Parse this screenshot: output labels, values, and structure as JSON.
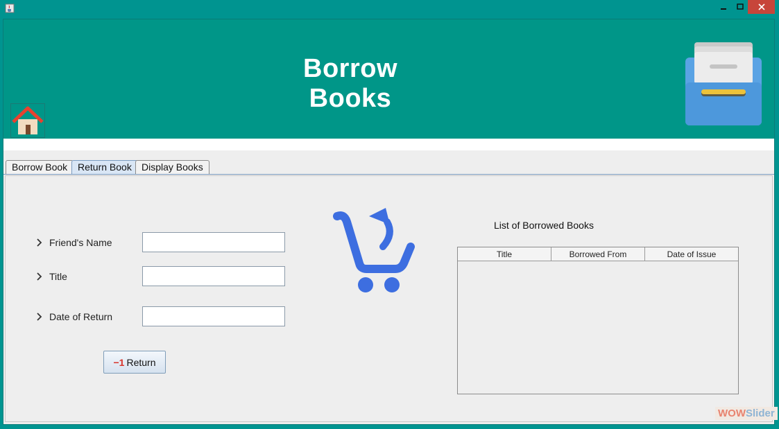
{
  "window": {
    "icon": "java-cup-icon"
  },
  "header": {
    "title": "Borrow Books",
    "home_icon": "home-icon",
    "drawer_icon": "file-drawer-icon"
  },
  "tabs": [
    {
      "label": "Borrow Book",
      "active": false
    },
    {
      "label": "Return Book",
      "active": true
    },
    {
      "label": "Display Books",
      "active": false
    }
  ],
  "form": {
    "fields": [
      {
        "label": "Friend's Name",
        "value": ""
      },
      {
        "label": "Title",
        "value": ""
      },
      {
        "label": "Date of Return",
        "value": ""
      }
    ],
    "return_label": "Return",
    "return_icon_text": "−1"
  },
  "center_icon": "cart-return-icon",
  "list": {
    "title": "List of Borrowed Books",
    "columns": [
      "Title",
      "Borrowed From",
      "Date of Issue"
    ],
    "rows": []
  },
  "watermark": {
    "part1": "WOW",
    "part2": "Slider"
  },
  "colors": {
    "teal": "#009688",
    "tab_active": "#d9e6f5",
    "close": "#c7453a",
    "cart_blue": "#3d6ee0"
  }
}
